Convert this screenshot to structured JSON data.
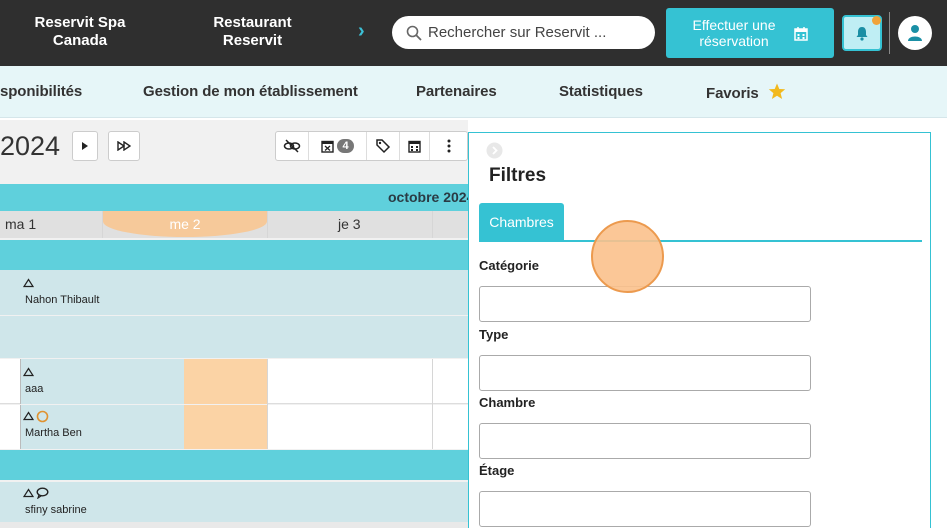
{
  "topbar": {
    "brand1": "Reservit Spa\nCanada",
    "brand1_l1": "Reservit Spa",
    "brand1_l2": "Canada",
    "brand2_l1": "Restaurant",
    "brand2_l2": "Reservit",
    "search_placeholder": "Rechercher sur Reservit ...",
    "book_l1": "Effectuer une",
    "book_l2": "réservation"
  },
  "nav": {
    "items": [
      "sponibilités",
      "Gestion de mon établissement",
      "Partenaires",
      "Statistiques",
      "Favoris"
    ]
  },
  "schedule": {
    "year": "2024",
    "badge_count": "4",
    "month": "octobre 2024",
    "days": [
      "ma 1",
      "me 2",
      "je 3"
    ],
    "guests": [
      "Nahon Thibault",
      "aaa",
      "Martha Ben",
      "sfiny sabrine"
    ]
  },
  "filters": {
    "title": "Filtres",
    "tab": "Chambres",
    "fields": [
      "Catégorie",
      "Type",
      "Chambre",
      "Étage"
    ]
  },
  "colors": {
    "accent": "#35c2d3",
    "topbar": "#2f2f2f",
    "highlight": "#fbd3a5"
  }
}
